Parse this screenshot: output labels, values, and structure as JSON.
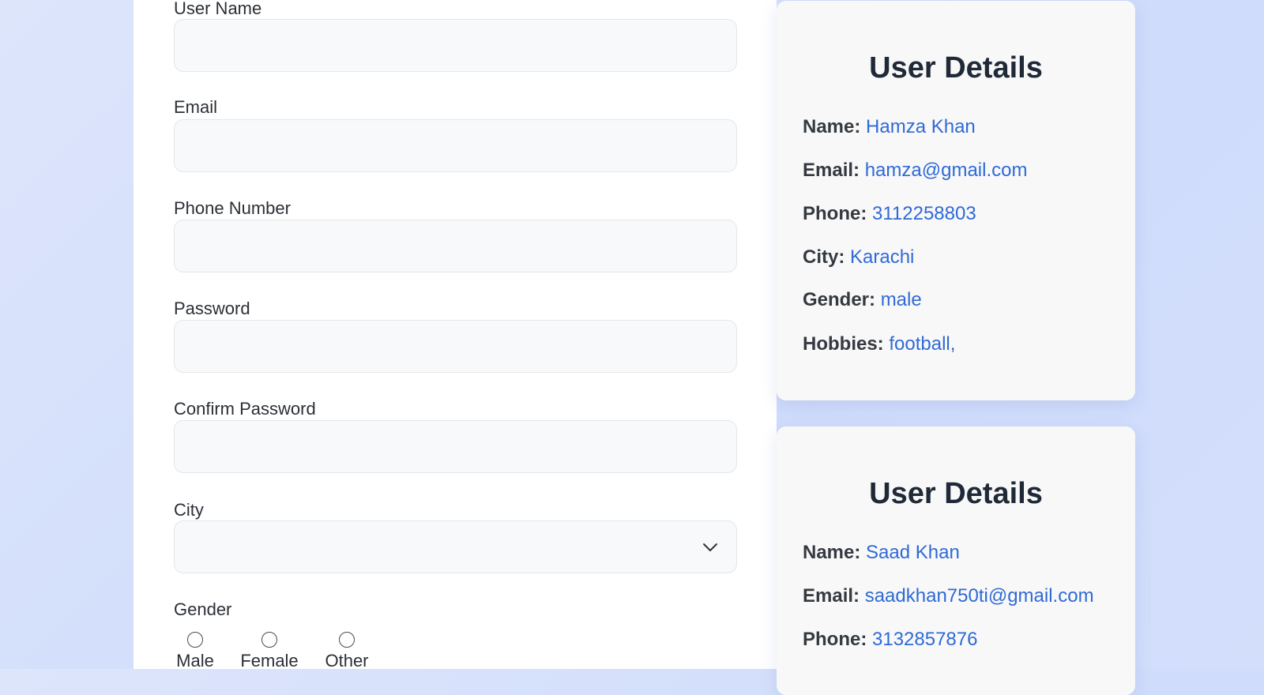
{
  "form": {
    "username_label": "User Name",
    "email_label": "Email",
    "phone_label": "Phone Number",
    "password_label": "Password",
    "confirm_password_label": "Confirm Password",
    "city_label": "City",
    "gender_label": "Gender",
    "gender_options": [
      "Male",
      "Female",
      "Other"
    ]
  },
  "cards": [
    {
      "title": "User Details",
      "rows": [
        {
          "key": "Name:",
          "value": "Hamza Khan"
        },
        {
          "key": "Email:",
          "value": "hamza@gmail.com"
        },
        {
          "key": "Phone:",
          "value": "3112258803"
        },
        {
          "key": "City:",
          "value": "Karachi"
        },
        {
          "key": "Gender:",
          "value": "male"
        },
        {
          "key": "Hobbies:",
          "value": "football,"
        }
      ]
    },
    {
      "title": "User Details",
      "rows": [
        {
          "key": "Name:",
          "value": "Saad Khan"
        },
        {
          "key": "Email:",
          "value": "saadkhan750ti@gmail.com"
        },
        {
          "key": "Phone:",
          "value": "3132857876"
        }
      ]
    }
  ],
  "colors": {
    "accent": "#2f6ad6"
  }
}
